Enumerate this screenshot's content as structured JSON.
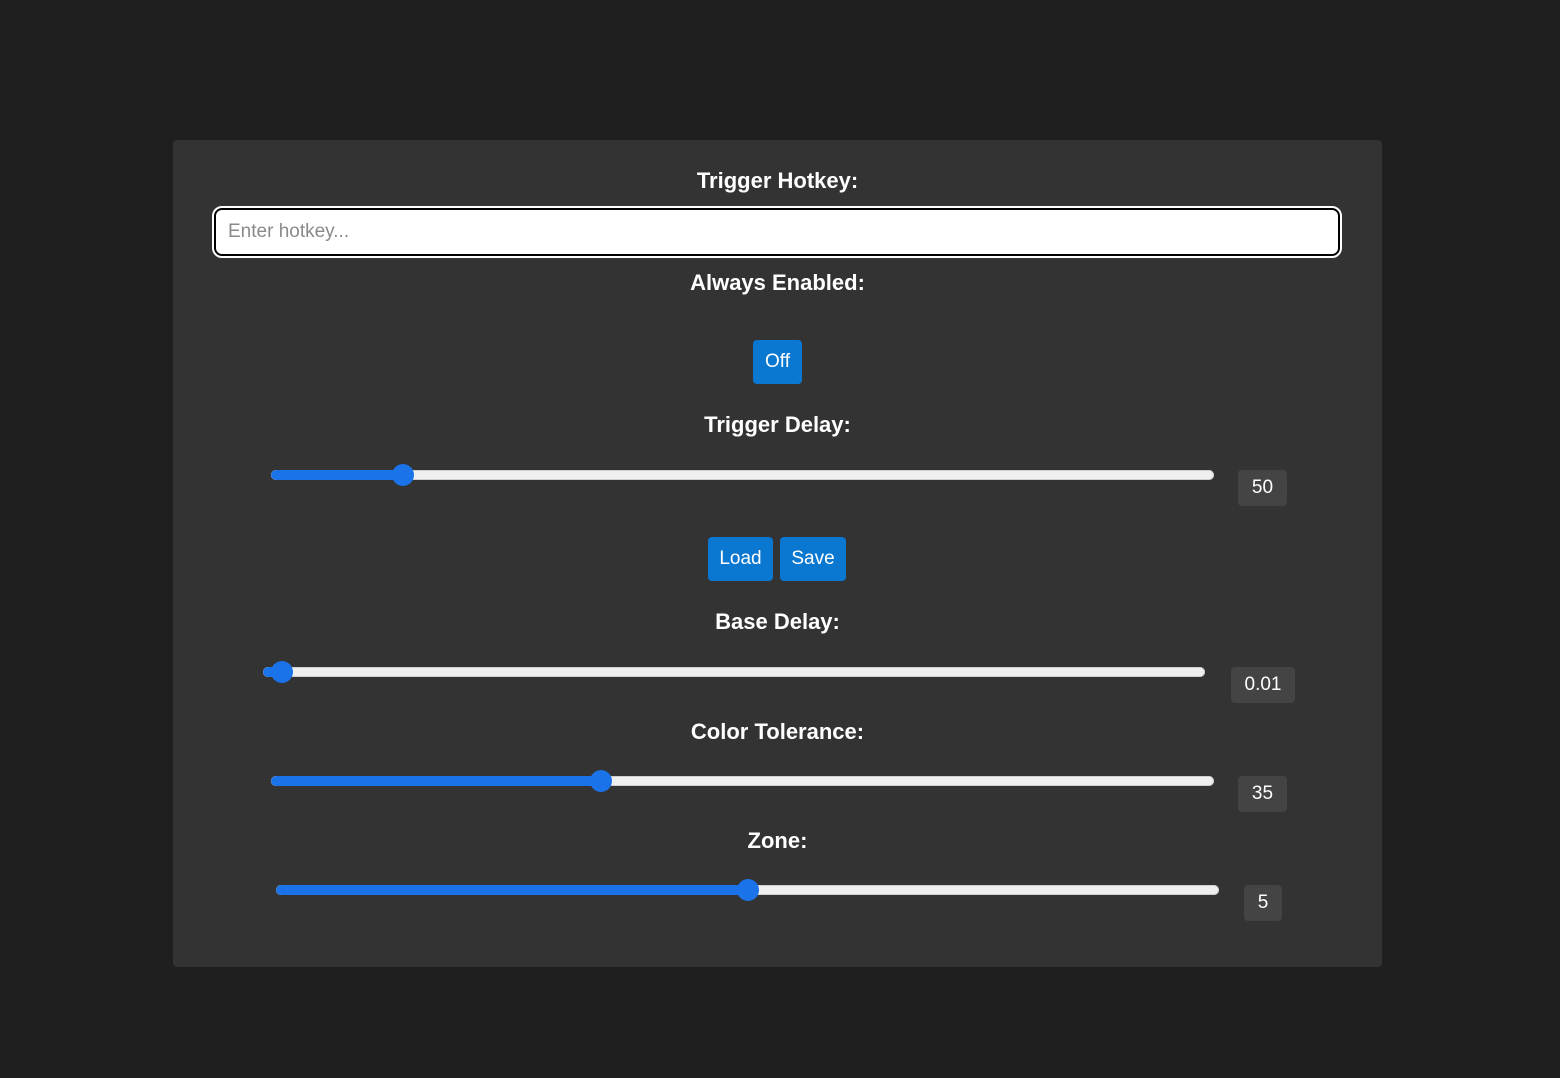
{
  "hotkey": {
    "label": "Trigger Hotkey:",
    "placeholder": "Enter hotkey...",
    "value": ""
  },
  "always_enabled": {
    "label": "Always Enabled:",
    "toggle_label": "Off"
  },
  "trigger_delay": {
    "label": "Trigger Delay:",
    "value": "50",
    "fraction": 0.14
  },
  "actions": {
    "load_label": "Load",
    "save_label": "Save"
  },
  "base_delay": {
    "label": "Base Delay:",
    "value": "0.01",
    "fraction": 0.02
  },
  "color_tolerance": {
    "label": "Color Tolerance:",
    "value": "35",
    "fraction": 0.35
  },
  "zone": {
    "label": "Zone:",
    "value": "5",
    "fraction": 0.5
  },
  "colors": {
    "background": "#1f1f1f",
    "panel": "#333333",
    "accent": "#0a78d0",
    "slider_fill": "#1a73e8"
  }
}
